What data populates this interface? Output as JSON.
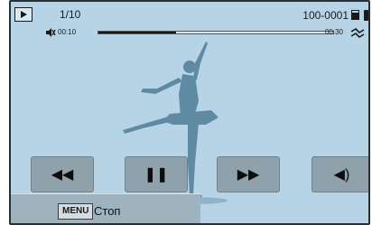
{
  "header": {
    "counter": "1/10",
    "file_number": "100-0001"
  },
  "playback": {
    "time_elapsed": "00:10",
    "time_total": "00:30",
    "progress": 0.33
  },
  "controls": [
    {
      "name": "rewind",
      "icon": "rewind-icon",
      "glyph": "◀◀"
    },
    {
      "name": "pause",
      "icon": "pause-icon",
      "glyph": "❚❚"
    },
    {
      "name": "fast-forward",
      "icon": "fast-forward-icon",
      "glyph": "▶▶"
    },
    {
      "name": "volume",
      "icon": "volume-icon",
      "glyph": "◀)"
    }
  ],
  "footer": {
    "menu_key": "MENU",
    "stop_label": "Стоп"
  },
  "colors": {
    "screen_background": "#b7d4e6",
    "button_background": "#8fa1ab",
    "silhouette": "#5f8aa3"
  }
}
